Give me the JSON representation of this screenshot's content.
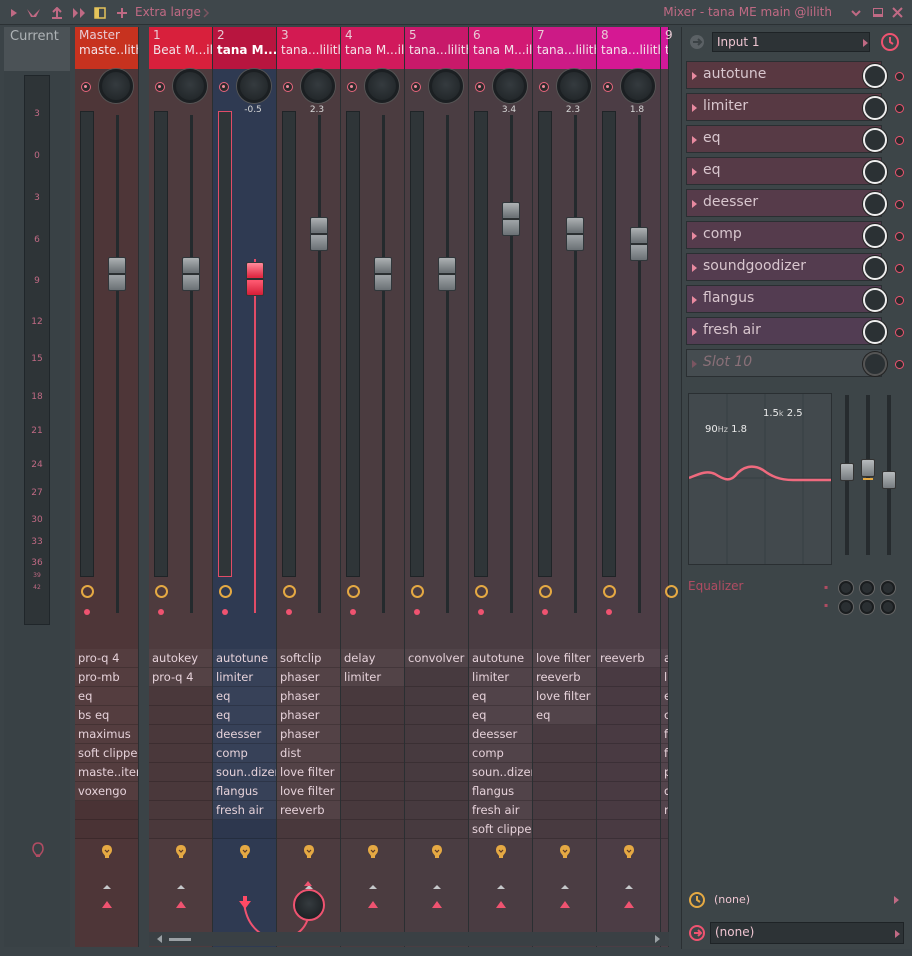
{
  "window": {
    "title": "Mixer - tana ME main @lilith",
    "zoom_label": "Extra large"
  },
  "current": {
    "label": "Current",
    "scale": [
      "3",
      "0",
      "3",
      "6",
      "9",
      "12",
      "15",
      "18",
      "21",
      "24",
      "27",
      "30",
      "33",
      "36",
      "39",
      "42"
    ]
  },
  "strips": [
    {
      "num": "Master",
      "name": "maste..lith",
      "pan": "",
      "fader_level": 0.78,
      "selected": false,
      "slots": [
        "pro-q 4",
        "pro-mb",
        "eq",
        "bs eq",
        "maximus",
        "soft clipper",
        "maste..iter",
        "voxengo"
      ]
    },
    {
      "num": "1",
      "name": "Beat M...ilith",
      "pan": "",
      "fader_level": 0.78,
      "selected": false,
      "slots": [
        "autokey",
        "pro-q 4"
      ]
    },
    {
      "num": "2",
      "name": "tana M...ilith",
      "pan": "-0.5",
      "fader_level": 0.77,
      "selected": true,
      "slots": [
        "autotune",
        "limiter",
        "eq",
        "eq",
        "deesser",
        "comp",
        "soun..dizer",
        "flangus",
        "fresh air"
      ]
    },
    {
      "num": "3",
      "name": "tana...lilith",
      "pan": "2.3",
      "fader_level": 0.86,
      "selected": false,
      "slots": [
        "softclip",
        "phaser",
        "phaser",
        "phaser",
        "phaser",
        "dist",
        "love filter",
        "love filter",
        "reeverb"
      ]
    },
    {
      "num": "4",
      "name": "tana M...ilith",
      "pan": "",
      "fader_level": 0.78,
      "selected": false,
      "slots": [
        "delay",
        "limiter"
      ]
    },
    {
      "num": "5",
      "name": "tana...lilith",
      "pan": "",
      "fader_level": 0.78,
      "selected": false,
      "slots": [
        "convolver"
      ]
    },
    {
      "num": "6",
      "name": "tana M...ilith",
      "pan": "3.4",
      "fader_level": 0.89,
      "selected": false,
      "slots": [
        "autotune",
        "limiter",
        "eq",
        "eq",
        "deesser",
        "comp",
        "soun..dizer",
        "flangus",
        "fresh air",
        "soft clipper"
      ]
    },
    {
      "num": "7",
      "name": "tana...lilith",
      "pan": "2.3",
      "fader_level": 0.86,
      "selected": false,
      "slots": [
        "love filter",
        "reeverb",
        "love filter",
        "eq"
      ]
    },
    {
      "num": "8",
      "name": "tana...lilith",
      "pan": "1.8",
      "fader_level": 0.84,
      "selected": false,
      "slots": [
        "reeverb"
      ]
    },
    {
      "num": "9",
      "name": "t",
      "pan": "",
      "fader_level": 0.84,
      "selected": false,
      "slots": [
        "a",
        "li",
        "e",
        "c",
        "fl",
        "fl",
        "p",
        "d",
        "r"
      ]
    }
  ],
  "panel": {
    "input": "Input 1",
    "fx_slots": [
      "autotune",
      "limiter",
      "eq",
      "eq",
      "deesser",
      "comp",
      "soundgoodizer",
      "flangus",
      "fresh air",
      "Slot 10"
    ],
    "eq": {
      "title": "Equalizer",
      "band1_freq": "90",
      "band1_unit": "Hz",
      "band1_q": "1.8",
      "band2_freq": "1.5",
      "band2_unit": "k",
      "band2_q": "2.5"
    },
    "output1": "(none)",
    "output2": "(none)"
  }
}
